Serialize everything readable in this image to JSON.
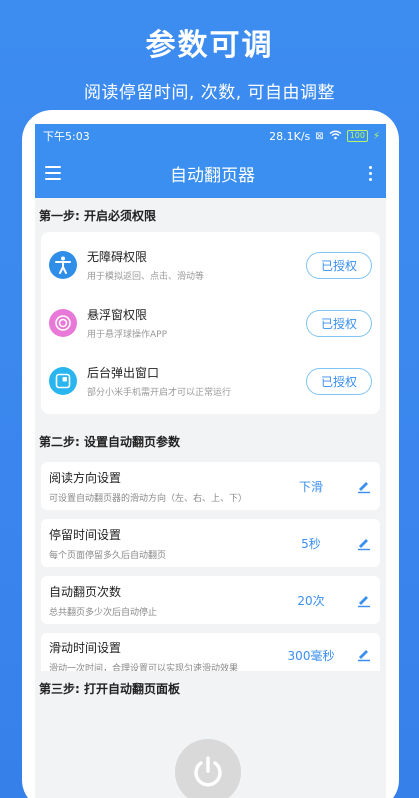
{
  "promo": {
    "title": "参数可调",
    "subtitle": "阅读停留时间, 次数, 可自由调整"
  },
  "status_bar": {
    "time": "下午5:03",
    "speed": "28.1K/s",
    "battery": "100"
  },
  "app_bar": {
    "title": "自动翻页器"
  },
  "step1": {
    "heading": "第一步: 开启必须权限",
    "items": [
      {
        "title": "无障碍权限",
        "desc": "用于模拟返回、点击、滑动等",
        "button": "已授权",
        "icon": "accessibility-icon",
        "color": "#2f8fe8"
      },
      {
        "title": "悬浮窗权限",
        "desc": "用于悬浮球操作APP",
        "button": "已授权",
        "icon": "floating-window-icon",
        "color": "#e879d8"
      },
      {
        "title": "后台弹出窗口",
        "desc": "部分小米手机需开启才可以正常运行",
        "button": "已授权",
        "icon": "popup-window-icon",
        "color": "#29b6f0"
      }
    ]
  },
  "step2": {
    "heading": "第二步: 设置自动翻页参数",
    "items": [
      {
        "title": "阅读方向设置",
        "desc": "可设置自动翻页器的滑动方向（左、右、上、下）",
        "value": "下滑"
      },
      {
        "title": "停留时间设置",
        "desc": "每个页面停留多久后自动翻页",
        "value": "5秒"
      },
      {
        "title": "自动翻页次数",
        "desc": "总共翻页多少次后自动停止",
        "value": "20次"
      },
      {
        "title": "滑动时间设置",
        "desc": "滑动一次时间，合理设置可以实现匀速滑动效果",
        "value": "300毫秒"
      }
    ]
  },
  "step3": {
    "heading": "第三步: 打开自动翻页面板"
  },
  "colors": {
    "accent": "#3a8ff0",
    "background": "#3a86ee"
  }
}
